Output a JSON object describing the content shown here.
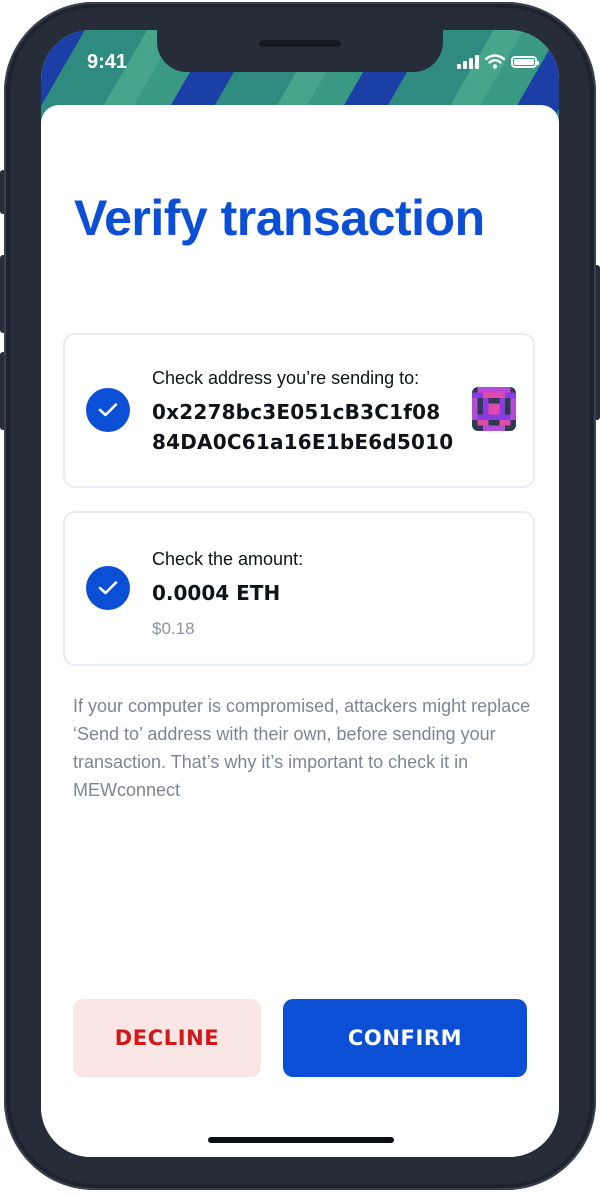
{
  "status_bar": {
    "time": "9:41"
  },
  "screen": {
    "title": "Verify transaction",
    "address_check": {
      "label": "Check address you’re sending to:",
      "address": "0x2278bc3E051cB3C1f0884DA0C61a16E1bE6d5010"
    },
    "amount_check": {
      "label": "Check the amount:",
      "amount": "0.0004 ETH",
      "fiat": "$0.18"
    },
    "info": "If your computer is compromised, attackers might replace ‘Send to’ address with their own, before sending your transaction. That’s why it’s important to check it in MEWconnect"
  },
  "actions": {
    "decline_label": "DECLINE",
    "confirm_label": "CONFIRM"
  },
  "colors": {
    "accent": "#0b4fd6",
    "decline_bg": "#fbe6e6",
    "decline_text": "#d01818"
  },
  "icons": [
    "check-icon",
    "identicon",
    "signal-icon",
    "wifi-icon",
    "battery-icon"
  ]
}
